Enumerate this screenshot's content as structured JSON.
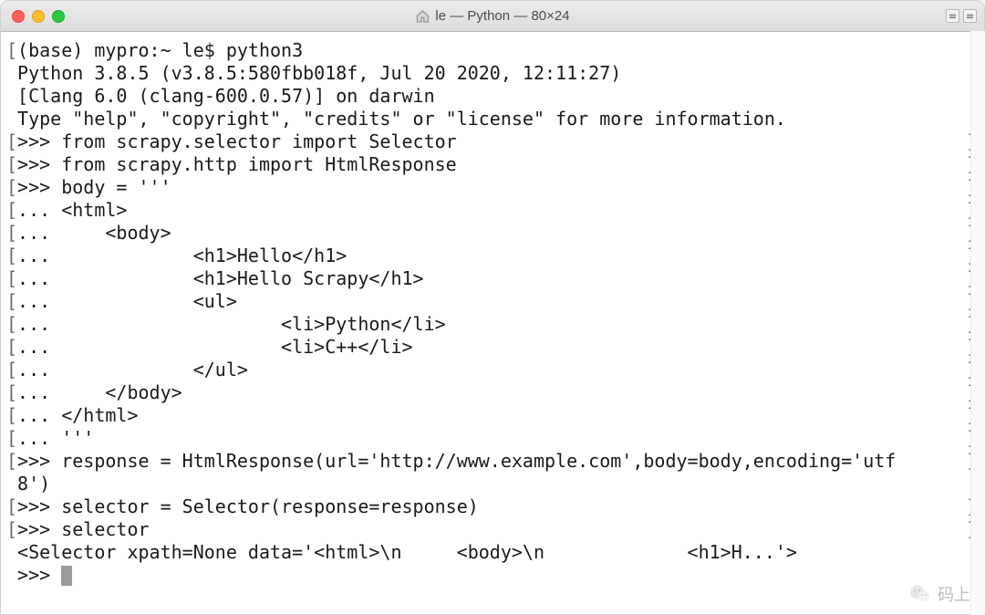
{
  "titlebar": {
    "title": "le — Python — 80×24"
  },
  "terminal": {
    "lines": [
      {
        "left": "[",
        "text": "(base) mypro:~ le$ python3",
        "right": ""
      },
      {
        "left": "",
        "text": "Python 3.8.5 (v3.8.5:580fbb018f, Jul 20 2020, 12:11:27)",
        "right": ""
      },
      {
        "left": "",
        "text": "[Clang 6.0 (clang-600.0.57)] on darwin",
        "right": ""
      },
      {
        "left": "",
        "text": "Type \"help\", \"copyright\", \"credits\" or \"license\" for more information.",
        "right": ""
      },
      {
        "left": "[",
        "text": ">>> from scrapy.selector import Selector",
        "right": "]"
      },
      {
        "left": "[",
        "text": ">>> from scrapy.http import HtmlResponse",
        "right": "]"
      },
      {
        "left": "[",
        "text": ">>> body = '''",
        "right": "]"
      },
      {
        "left": "[",
        "text": "... <html>",
        "right": "]"
      },
      {
        "left": "[",
        "text": "...     <body>",
        "right": "]"
      },
      {
        "left": "[",
        "text": "...             <h1>Hello</h1>",
        "right": "]"
      },
      {
        "left": "[",
        "text": "...             <h1>Hello Scrapy</h1>",
        "right": "]"
      },
      {
        "left": "[",
        "text": "...             <ul>",
        "right": "]"
      },
      {
        "left": "[",
        "text": "...                     <li>Python</li>",
        "right": "]"
      },
      {
        "left": "[",
        "text": "...                     <li>C++</li>",
        "right": "]"
      },
      {
        "left": "[",
        "text": "...             </ul>",
        "right": "]"
      },
      {
        "left": "[",
        "text": "...     </body>",
        "right": "]"
      },
      {
        "left": "[",
        "text": "... </html>",
        "right": "]"
      },
      {
        "left": "[",
        "text": "... '''",
        "right": "]"
      },
      {
        "left": "[",
        "text": ">>> response = HtmlResponse(url='http://www.example.com',body=body,encoding='utf",
        "right": "]"
      },
      {
        "left": "",
        "text": "8')",
        "right": ""
      },
      {
        "left": "[",
        "text": ">>> selector = Selector(response=response)",
        "right": "]"
      },
      {
        "left": "[",
        "text": ">>> selector",
        "right": "]"
      },
      {
        "left": "",
        "text": "<Selector xpath=None data='<html>\\n     <body>\\n             <h1>H...'>",
        "right": ""
      },
      {
        "left": "",
        "text": ">>> ",
        "right": "",
        "cursor": true
      }
    ]
  },
  "watermark": {
    "text": "码上"
  }
}
